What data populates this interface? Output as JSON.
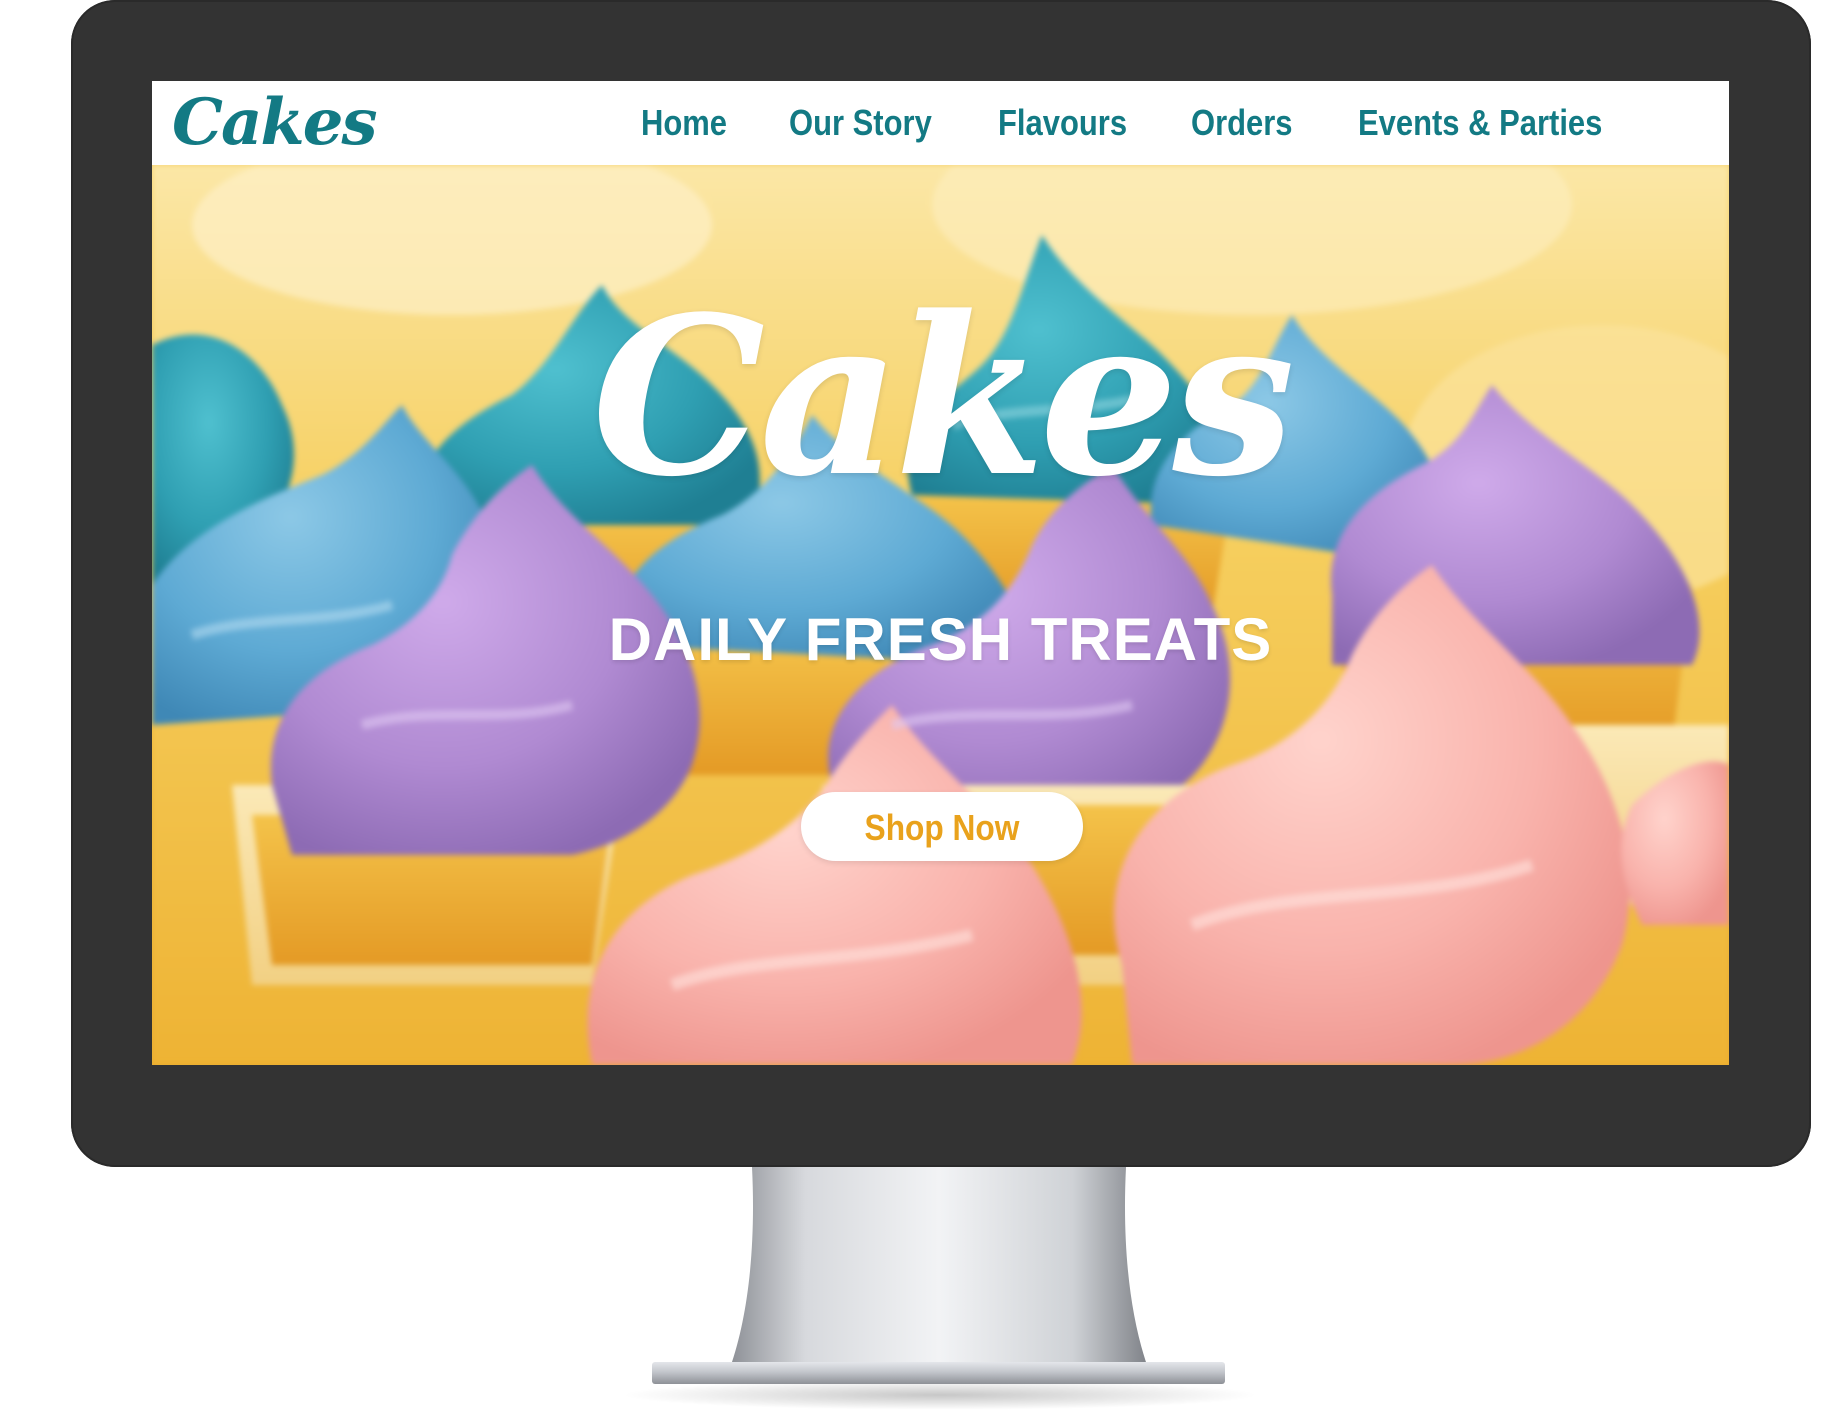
{
  "header": {
    "logo_text": "Cakes",
    "nav": [
      {
        "label": "Home"
      },
      {
        "label": "Our Story"
      },
      {
        "label": "Flavours"
      },
      {
        "label": "Orders"
      },
      {
        "label": "Events & Parties"
      }
    ]
  },
  "hero": {
    "title": "Cakes",
    "tagline": "DAILY FRESH TREATS",
    "cta_label": "Shop Now",
    "background_image": "cupcakes-with-frosting-photo"
  },
  "colors": {
    "brand_teal": "#137a84",
    "cta_text": "#e9a21c",
    "hero_yellow": "#f1c24a",
    "frosting_teal": "#3fa6b8",
    "frosting_blue": "#6fb4da",
    "frosting_purple": "#b58dd4",
    "frosting_pink": "#f8b2ad",
    "bezel": "#333333"
  }
}
